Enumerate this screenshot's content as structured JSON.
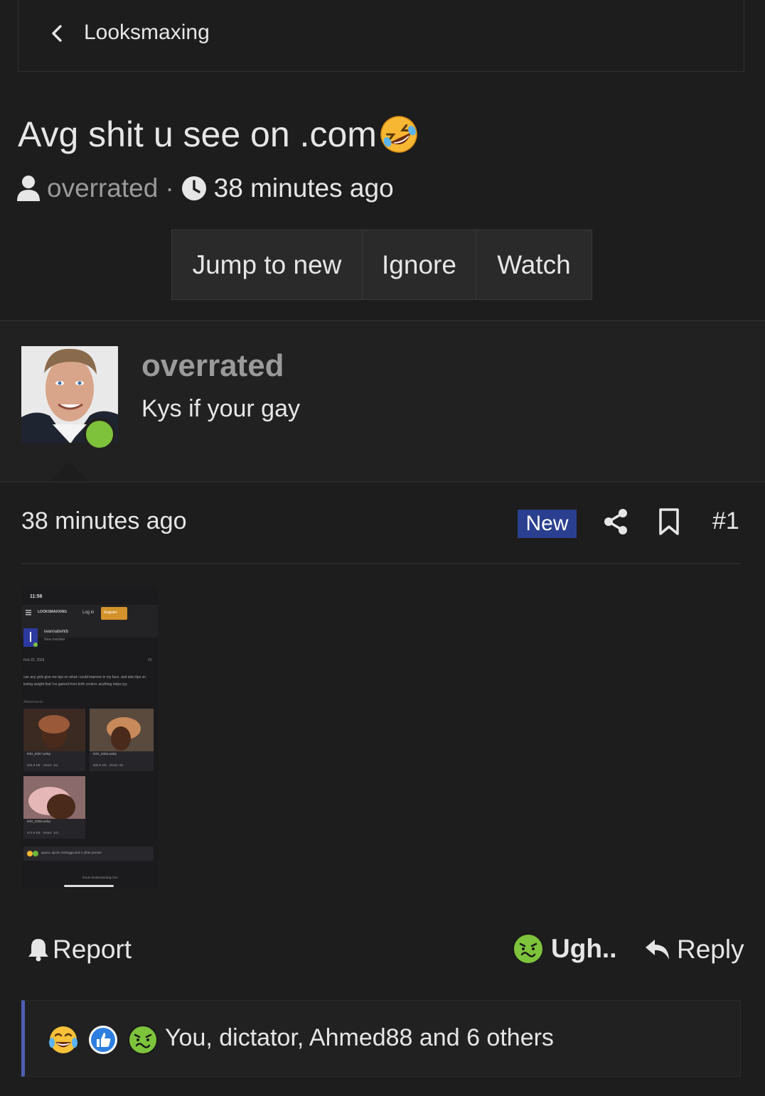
{
  "nav": {
    "back_label": "Looksmaxing"
  },
  "thread": {
    "title": "Avg shit u see on .com",
    "title_emoji": "rolling-on-floor-laughing-icon",
    "author": "overrated",
    "separator": "·",
    "time": "38 minutes ago"
  },
  "actions": {
    "jump_to_new": "Jump to new",
    "ignore": "Ignore",
    "watch": "Watch"
  },
  "post": {
    "author": "overrated",
    "user_title": "Kys if your gay",
    "online": true,
    "time": "38 minutes ago",
    "new_badge": "New",
    "number": "#1",
    "attachment": {
      "status_time": "11:56",
      "site_brand": "LOOKSMAXXING",
      "login": "Log in",
      "register": "Register",
      "op_name": "iwannabehtb",
      "op_title": "New member",
      "op_date": "Feb 22, 2026",
      "op_number": "#1",
      "op_body": "can any girls give me tips on what i could improve in my face. and also tips on losing weight that i've gained from birth control. anything helps tyy.",
      "attachments_label": "Attachments",
      "files": [
        {
          "name": "IMG_8357.webp",
          "meta": "505.9 KB · Views: 111"
        },
        {
          "name": "IMG_8356.webp",
          "meta": "606.5 KB · Views: 99"
        },
        {
          "name": "IMG_8359.webp",
          "meta": "572.8 KB · Views: 101"
        }
      ],
      "reactions": "quan1, ajc19, NOvigga and 1 other person",
      "footer_url": "forum.looksmaxxing.com"
    }
  },
  "footer_actions": {
    "report": "Report",
    "reaction": "Ugh..",
    "reply": "Reply"
  },
  "reactions": {
    "icons": [
      "crying-laughing-icon",
      "thumbs-up-icon",
      "sick-face-icon"
    ],
    "text": "You, dictator, Ahmed88 and 6 others"
  },
  "colors": {
    "background": "#1d1d1d",
    "new_badge": "#2a3f8f",
    "online": "#7ec13a",
    "accent_bar": "#4f5fb4",
    "muted_text": "#9a9a9a"
  }
}
